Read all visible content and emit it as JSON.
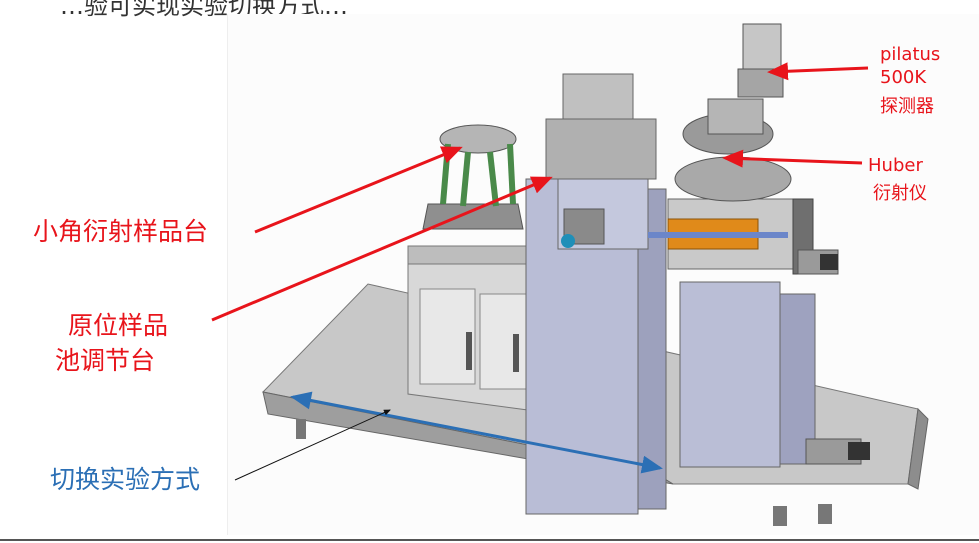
{
  "header_fragment": "…验可实现实验切换方式…",
  "labels": {
    "small_angle": "小角衍射样品台",
    "in_situ_line1": "原位样品",
    "in_situ_line2": "池调节台",
    "switch_mode": "切换实验方式",
    "pilatus_line1": "pilatus",
    "pilatus_line2": "500K",
    "pilatus_line3": "探测器",
    "huber_line1": "Huber",
    "huber_line2": "衍射仪"
  },
  "colors": {
    "annotation_red": "#e8141b",
    "annotation_blue": "#2b6fb5"
  }
}
